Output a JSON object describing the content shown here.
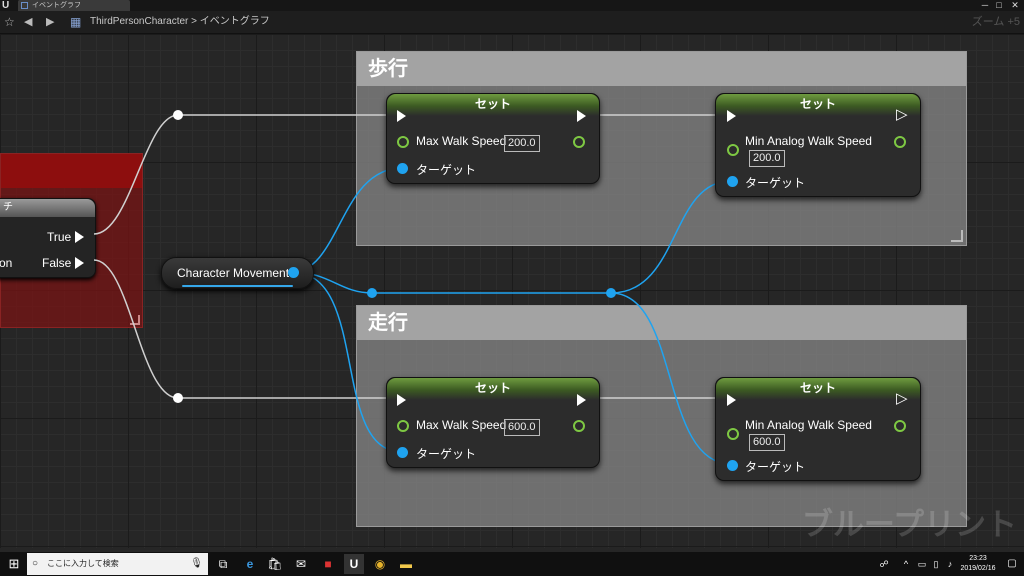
{
  "window": {
    "tab_title": "イベントグラフ",
    "minimize": "─",
    "maximize": "□",
    "close": "✕"
  },
  "toolbar": {
    "breadcrumb_blueprint": "ThirdPersonCharacter",
    "breadcrumb_separator": ">",
    "breadcrumb_graph": "イベントグラフ",
    "zoom": "ズーム +5"
  },
  "comments": {
    "walk": "歩行",
    "run": "走行"
  },
  "branch": {
    "title": "チ",
    "true_label": "True",
    "false_label": "False",
    "condition_partial": "on"
  },
  "variable": {
    "label": "Character Movement"
  },
  "nodes": {
    "walk_max": {
      "title": "セット",
      "prop": "Max Walk Speed",
      "value": "200.0",
      "target": "ターゲット"
    },
    "walk_min": {
      "title": "セット",
      "prop": "Min Analog Walk Speed",
      "value": "200.0",
      "target": "ターゲット"
    },
    "run_max": {
      "title": "セット",
      "prop": "Max Walk Speed",
      "value": "600.0",
      "target": "ターゲット"
    },
    "run_min": {
      "title": "セット",
      "prop": "Min Analog Walk Speed",
      "value": "600.0",
      "target": "ターゲット"
    }
  },
  "watermark": "ブループリント",
  "taskbar": {
    "search_placeholder": "ここに入力して検索",
    "time": "23:23",
    "date": "2019/02/16"
  },
  "colors": {
    "exec_wire": "#d0d0d0",
    "object_wire": "#1fa3f0",
    "float_pin": "#7ec843",
    "set_header": "#6e9b3f",
    "comment_body": "#808080",
    "branch_comment": "#8d0e0e"
  },
  "icons": [
    "ue-logo-icon",
    "tab-blueprint-icon",
    "favorite-star-icon",
    "back-arrow-icon",
    "forward-arrow-icon",
    "graph-icon",
    "windows-start-icon",
    "search-icon",
    "microphone-icon",
    "task-view-icon",
    "edge-icon",
    "store-icon",
    "mail-icon",
    "app-icon",
    "unreal-icon",
    "chrome-icon",
    "explorer-icon",
    "notification-icon"
  ]
}
